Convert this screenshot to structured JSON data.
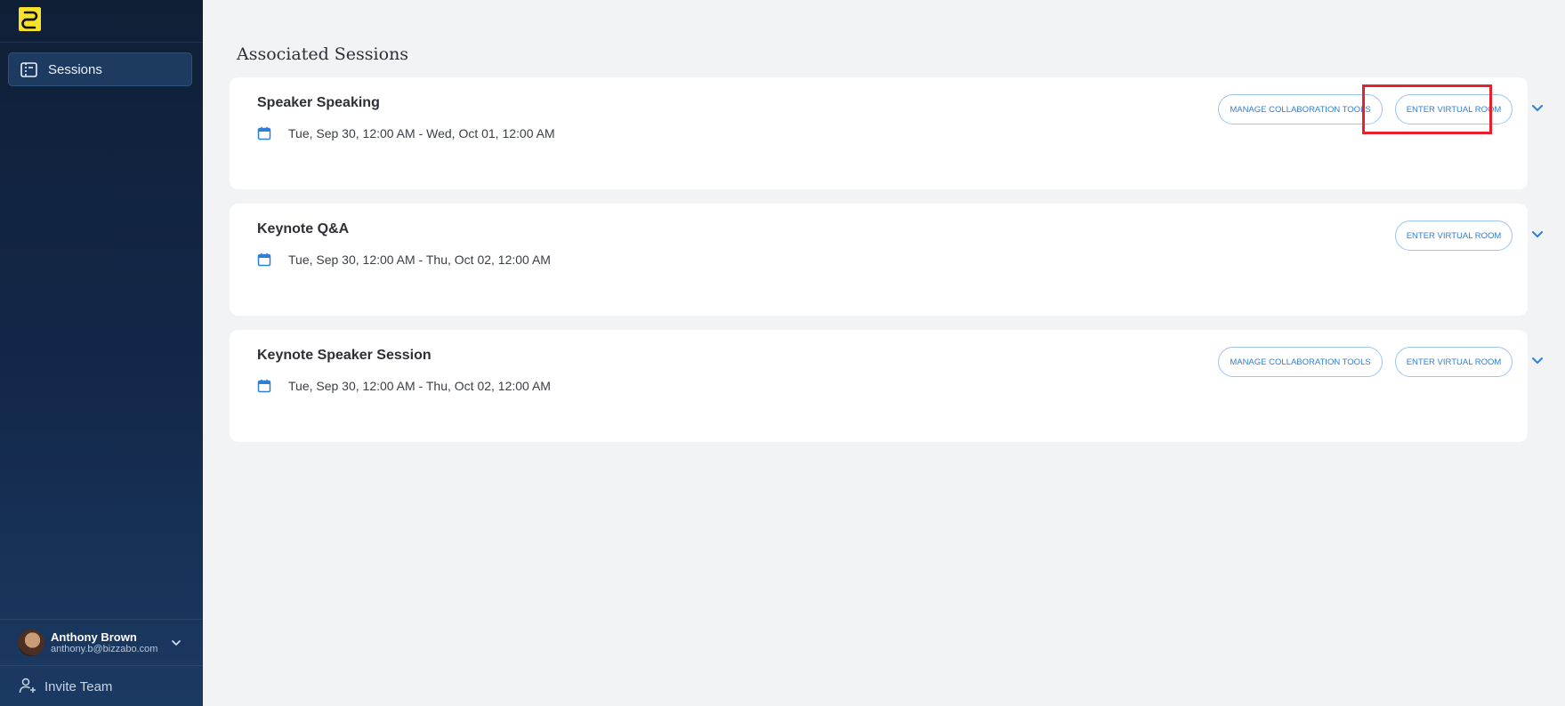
{
  "sidebar": {
    "nav": [
      {
        "label": "Sessions",
        "icon": "ticket-icon"
      }
    ],
    "user": {
      "name": "Anthony Brown",
      "email": "anthony.b@bizzabo.com"
    },
    "invite_label": "Invite Team"
  },
  "main": {
    "title": "Associated Sessions",
    "sessions": [
      {
        "title": "Speaker Speaking",
        "date": "Tue, Sep 30, 12:00 AM - Wed, Oct 01, 12:00 AM",
        "manage_label": "MANAGE COLLABORATION TOOLS",
        "enter_label": "ENTER VIRTUAL ROOM"
      },
      {
        "title": "Keynote Q&A",
        "date": "Tue, Sep 30, 12:00 AM - Thu, Oct 02, 12:00 AM",
        "enter_label": "ENTER VIRTUAL ROOM"
      },
      {
        "title": "Keynote Speaker Session",
        "date": "Tue, Sep 30, 12:00 AM - Thu, Oct 02, 12:00 AM",
        "manage_label": "MANAGE COLLABORATION TOOLS",
        "enter_label": "ENTER VIRTUAL ROOM"
      }
    ]
  },
  "colors": {
    "accent": "#2f7fd6",
    "highlight": "#e8202a",
    "brand": "#f7e12b"
  }
}
